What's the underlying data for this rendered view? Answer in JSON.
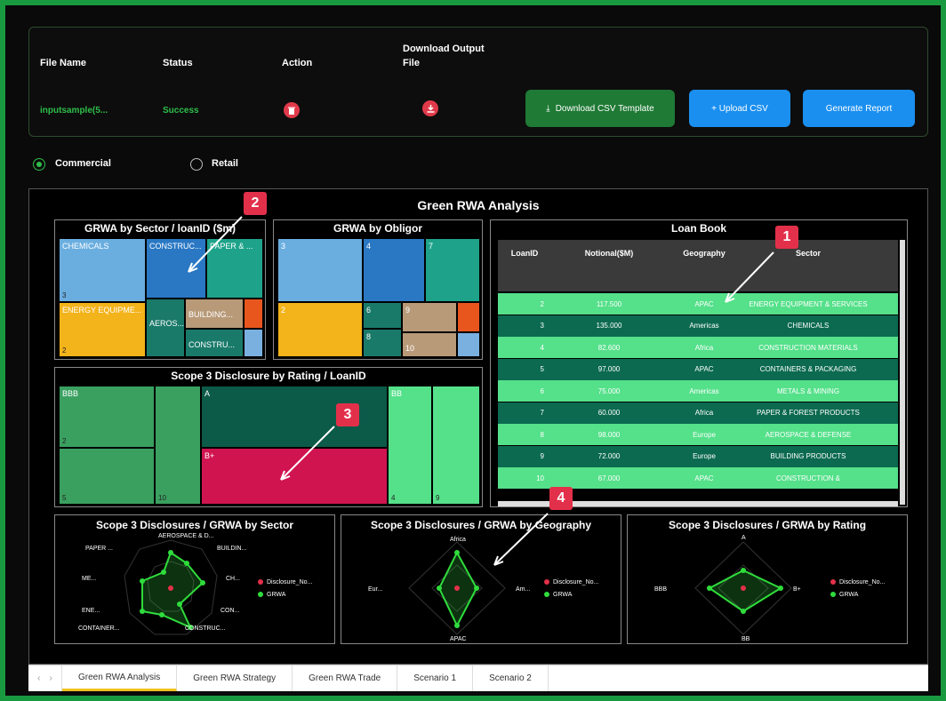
{
  "upload": {
    "headers": {
      "file_name": "File Name",
      "status": "Status",
      "action": "Action",
      "download": "Download Output\nFile"
    },
    "row": {
      "file_name": "inputsample(5...",
      "status": "Success"
    },
    "buttons": {
      "download_csv": "Download CSV Template",
      "upload_csv": "+ Upload CSV",
      "generate": "Generate Report"
    }
  },
  "radios": {
    "commercial": "Commercial",
    "retail": "Retail",
    "selected": "Commercial"
  },
  "report": {
    "title": "Green RWA Analysis",
    "sector_title": "GRWA by Sector / loanID ($m)",
    "obligor_title": "GRWA by Obligor",
    "scope_title": "Scope 3 Disclosure by Rating / LoanID",
    "loanbook": {
      "title": "Loan Book",
      "headers": [
        "LoanID",
        "Notional($M)",
        "Geography",
        "Sector"
      ],
      "rows": [
        [
          "2",
          "117.500",
          "APAC",
          "ENERGY EQUIPMENT & SERVICES"
        ],
        [
          "3",
          "135.000",
          "Americas",
          "CHEMICALS"
        ],
        [
          "4",
          "82.600",
          "Africa",
          "CONSTRUCTION MATERIALS"
        ],
        [
          "5",
          "97.000",
          "APAC",
          "CONTAINERS & PACKAGING"
        ],
        [
          "6",
          "75.000",
          "Americas",
          "METALS & MINING"
        ],
        [
          "7",
          "60.000",
          "Africa",
          "PAPER & FOREST PRODUCTS"
        ],
        [
          "8",
          "98.000",
          "Europe",
          "AEROSPACE & DEFENSE"
        ],
        [
          "9",
          "72.000",
          "Europe",
          "BUILDING PRODUCTS"
        ],
        [
          "10",
          "67.000",
          "APAC",
          "CONSTRUCTION &"
        ]
      ]
    },
    "sector_tiles": {
      "chemicals": "CHEMICALS",
      "construct": "CONSTRUC...",
      "paper": "PAPER & ...",
      "energy": "ENERGY EQUIPME...",
      "aeros": "AEROS...",
      "building": "BUILDING...",
      "constru": "CONSTRU...",
      "n3": "3",
      "n2": "2"
    },
    "obligor_tiles": {
      "n3": "3",
      "n4": "4",
      "n7": "7",
      "n2": "2",
      "n6": "6",
      "n8": "8",
      "n9": "9",
      "n10": "10"
    },
    "scope_tiles": {
      "bbb": "BBB",
      "a": "A",
      "bbplus": "B+",
      "bb": "BB",
      "n2": "2",
      "n5": "5",
      "n10": "10",
      "n4": "4",
      "n9": "9"
    },
    "radar_sector": {
      "title": "Scope 3 Disclosures / GRWA by Sector",
      "labels": [
        "AEROSPACE & D...",
        "BUILDIN...",
        "CH...",
        "CON...",
        "CONSTRUC...",
        "CONTAINER...",
        "ENE...",
        "ME...",
        "PAPER ..."
      ]
    },
    "radar_geo": {
      "title": "Scope 3 Disclosures / GRWA by Geography",
      "labels": [
        "Africa",
        "Am...",
        "APAC",
        "Eur..."
      ]
    },
    "radar_rating": {
      "title": "Scope 3 Disclosures / GRWA by Rating",
      "labels": [
        "A",
        "B+",
        "BB",
        "BBB"
      ]
    },
    "legend": {
      "disclosure": "Disclosure_No...",
      "grwa": "GRWA"
    }
  },
  "markers": [
    "1",
    "2",
    "3",
    "4"
  ],
  "tabs": [
    "Green RWA Analysis",
    "Green RWA Strategy",
    "Green RWA Trade",
    "Scenario 1",
    "Scenario 2"
  ],
  "colors": {
    "frame": "#1a9a40",
    "green_row": "#55e08a",
    "dark_row": "#0c6a50",
    "accent_red": "#e3304a"
  }
}
